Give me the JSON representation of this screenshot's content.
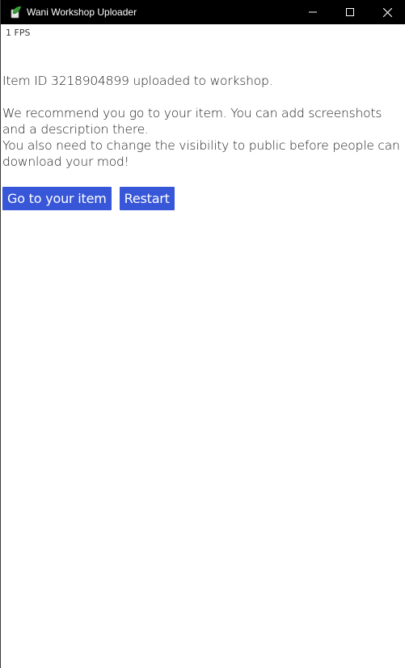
{
  "window": {
    "title": "Wani Workshop Uploader",
    "icon": "leaf-app-icon",
    "controls": [
      "minimize-icon",
      "maximize-icon",
      "close-icon"
    ]
  },
  "fps_label": "1 FPS",
  "message": {
    "line1": "Item ID 3218904899 uploaded to workshop.",
    "line2": "We recommend you go to your item. You can add screenshots and a description there.",
    "line3": "You also need to change the visibility to public before people can download your mod!"
  },
  "buttons": {
    "go_to_item": "Go to your item",
    "restart": "Restart"
  },
  "colors": {
    "titlebar": "#000000",
    "button_bg": "#3756d8",
    "button_text": "#ffffff",
    "text": "#1e1e1e"
  }
}
